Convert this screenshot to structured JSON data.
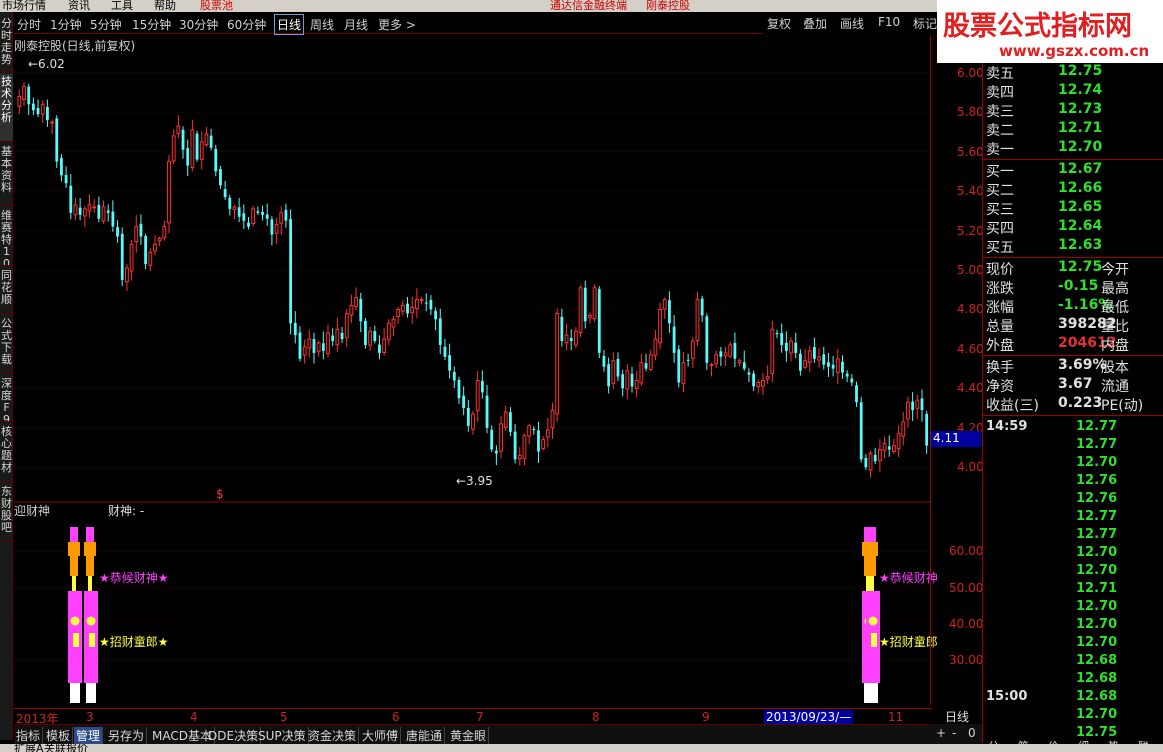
{
  "top_menu": {
    "items": [
      "市场行情",
      "资讯",
      "工具",
      "帮助",
      "股票池"
    ],
    "center_items": [
      "通达信金融终端",
      "刚泰控股"
    ]
  },
  "left_tabs": [
    "分时走势",
    "技术分析",
    "基本资料",
    "维赛特10",
    "同花顺",
    "公式下载",
    "深度F9",
    "核心题材",
    "东财股吧"
  ],
  "period_bar": {
    "items": [
      "分时",
      "1分钟",
      "5分钟",
      "15分钟",
      "30分钟",
      "60分钟",
      "日线",
      "周线",
      "月线",
      "更多 >"
    ],
    "active": "日线"
  },
  "right_buttons": [
    "复权",
    "叠加",
    "画线",
    "F10",
    "标记"
  ],
  "watermark": {
    "title": "股票公式指标网",
    "url": "www.gszx.com.cn"
  },
  "chart": {
    "title": "刚泰控股(日线,前复权)",
    "high_label": "6.02",
    "low_label": "3.95",
    "current_price_tag": "4.11",
    "marker_symbol": "$",
    "indicator_title": "迎财神",
    "indicator_label": "财神: -",
    "annot_magenta": "★恭候财神★",
    "annot_yellow": "★招财童郎★",
    "annot_magenta_right": "★恭候财神",
    "annot_yellow_right": "★招财童郎"
  },
  "chart_data": {
    "type": "candlestick",
    "title": "刚泰控股(日线,前复权)",
    "yticks_main": [
      "6.00",
      "5.80",
      "5.60",
      "5.40",
      "5.20",
      "5.00",
      "4.80",
      "4.60",
      "4.40",
      "4.20",
      "4.00"
    ],
    "ylim_main": [
      3.9,
      6.08
    ],
    "yticks_sub": [
      "60.00",
      "50.00",
      "40.00",
      "30.00"
    ],
    "ylim_sub": [
      19,
      70
    ],
    "x_labels": [
      "2013年",
      "3",
      "4",
      "5",
      "6",
      "7",
      "8",
      "9",
      "2013/09/23/—",
      "11"
    ],
    "closes": [
      5.88,
      5.93,
      5.84,
      5.81,
      5.79,
      5.84,
      5.76,
      5.75,
      5.55,
      5.48,
      5.44,
      5.29,
      5.33,
      5.28,
      5.31,
      5.33,
      5.32,
      5.26,
      5.32,
      5.29,
      5.22,
      5.17,
      4.95,
      5.01,
      5.13,
      5.22,
      5.17,
      5.03,
      5.09,
      5.13,
      5.16,
      5.22,
      5.55,
      5.68,
      5.73,
      5.61,
      5.53,
      5.71,
      5.56,
      5.65,
      5.69,
      5.62,
      5.5,
      5.43,
      5.37,
      5.31,
      5.32,
      5.27,
      5.25,
      5.22,
      5.31,
      5.29,
      5.28,
      5.26,
      5.18,
      5.23,
      5.29,
      5.25,
      4.73,
      4.67,
      4.55,
      4.61,
      4.65,
      4.58,
      4.63,
      4.59,
      4.68,
      4.64,
      4.7,
      4.65,
      4.78,
      4.82,
      4.86,
      4.74,
      4.62,
      4.69,
      4.64,
      4.58,
      4.65,
      4.73,
      4.75,
      4.8,
      4.82,
      4.78,
      4.81,
      4.85,
      4.85,
      4.83,
      4.8,
      4.75,
      4.62,
      4.56,
      4.49,
      4.44,
      4.35,
      4.3,
      4.21,
      4.27,
      4.44,
      4.38,
      4.2,
      4.09,
      4.07,
      4.22,
      4.28,
      4.18,
      4.04,
      4.06,
      4.16,
      4.21,
      4.19,
      4.08,
      4.14,
      4.19,
      4.29,
      4.78,
      4.64,
      4.67,
      4.64,
      4.69,
      4.91,
      4.74,
      4.77,
      4.91,
      4.58,
      4.51,
      4.41,
      4.54,
      4.46,
      4.4,
      4.49,
      4.41,
      4.44,
      4.53,
      4.5,
      4.57,
      4.65,
      4.8,
      4.85,
      4.73,
      4.58,
      4.43,
      4.53,
      4.54,
      4.64,
      4.85,
      4.77,
      4.53,
      4.52,
      4.57,
      4.56,
      4.58,
      4.62,
      4.55,
      4.54,
      4.5,
      4.47,
      4.41,
      4.43,
      4.44,
      4.46,
      4.7,
      4.68,
      4.62,
      4.59,
      4.64,
      4.58,
      4.49,
      4.54,
      4.59,
      4.55,
      4.56,
      4.52,
      4.51,
      4.5,
      4.55,
      4.48,
      4.46,
      4.43,
      4.33,
      4.04,
      4.0,
      4.07,
      4.03,
      4.09,
      4.12,
      4.09,
      4.11,
      4.17,
      4.23,
      4.33,
      4.29,
      4.34,
      4.29,
      4.11
    ]
  },
  "quote": {
    "sell": [
      {
        "label": "卖五",
        "price": "12.75"
      },
      {
        "label": "卖四",
        "price": "12.74"
      },
      {
        "label": "卖三",
        "price": "12.73"
      },
      {
        "label": "卖二",
        "price": "12.71"
      },
      {
        "label": "卖一",
        "price": "12.70"
      }
    ],
    "buy": [
      {
        "label": "买一",
        "price": "12.67"
      },
      {
        "label": "买二",
        "price": "12.66"
      },
      {
        "label": "买三",
        "price": "12.65"
      },
      {
        "label": "买四",
        "price": "12.64"
      },
      {
        "label": "买五",
        "price": "12.63"
      }
    ],
    "stats1": [
      {
        "label": "现价",
        "value": "12.75",
        "label2": "今开"
      },
      {
        "label": "涨跌",
        "value": "-0.15",
        "label2": "最高"
      },
      {
        "label": "涨幅",
        "value": "-1.16%",
        "label2": "最低"
      },
      {
        "label": "总量",
        "value": "398282",
        "label2": "量比"
      },
      {
        "label": "外盘",
        "value": "204612",
        "label2": "内盘"
      }
    ],
    "stats2": [
      {
        "label": "换手",
        "value": "3.69%",
        "label2": "股本"
      },
      {
        "label": "净资",
        "value": "3.67",
        "label2": "流通"
      },
      {
        "label": "收益(三)",
        "value": "0.223",
        "label2": "PE(动)"
      }
    ],
    "ticks": [
      {
        "time": "14:59",
        "price": "12.77"
      },
      {
        "time": "",
        "price": "12.77"
      },
      {
        "time": "",
        "price": "12.70"
      },
      {
        "time": "",
        "price": "12.76"
      },
      {
        "time": "",
        "price": "12.76"
      },
      {
        "time": "",
        "price": "12.77"
      },
      {
        "time": "",
        "price": "12.77"
      },
      {
        "time": "",
        "price": "12.70"
      },
      {
        "time": "",
        "price": "12.70"
      },
      {
        "time": "",
        "price": "12.71"
      },
      {
        "time": "",
        "price": "12.70"
      },
      {
        "time": "",
        "price": "12.70"
      },
      {
        "time": "",
        "price": "12.70"
      },
      {
        "time": "",
        "price": "12.68"
      },
      {
        "time": "",
        "price": "12.68"
      },
      {
        "time": "15:00",
        "price": "12.68"
      },
      {
        "time": "",
        "price": "12.70"
      },
      {
        "time": "",
        "price": "12.75"
      }
    ],
    "bottom_tabs": [
      "分",
      "笔",
      "价",
      "细",
      "势",
      "联"
    ]
  },
  "date_axis_period": "日线",
  "bottom_tabs": [
    "指标",
    "模板",
    "管理",
    "另存为",
    "MACD基本",
    "DDE决策",
    "SUP决策",
    "资金决策",
    "大师傅",
    "唐能通",
    "黄金眼"
  ],
  "bottom_active": "管理",
  "scroll": [
    "+",
    "-",
    "0"
  ],
  "status_items": [
    "扩展A",
    "关联报价"
  ]
}
